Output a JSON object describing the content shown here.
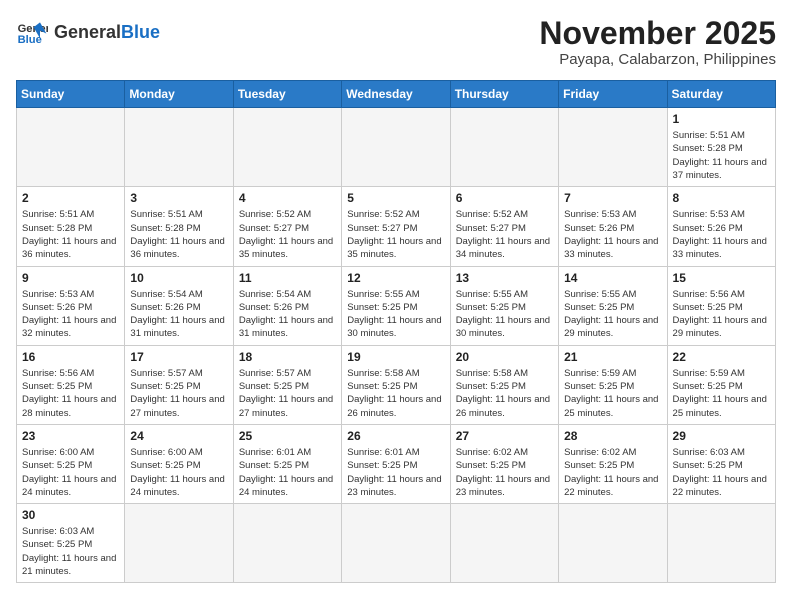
{
  "logo": {
    "general": "General",
    "blue": "Blue"
  },
  "header": {
    "month": "November 2025",
    "location": "Payapa, Calabarzon, Philippines"
  },
  "weekdays": [
    "Sunday",
    "Monday",
    "Tuesday",
    "Wednesday",
    "Thursday",
    "Friday",
    "Saturday"
  ],
  "days": {
    "1": {
      "sunrise": "5:51 AM",
      "sunset": "5:28 PM",
      "daylight": "11 hours and 37 minutes."
    },
    "2": {
      "sunrise": "5:51 AM",
      "sunset": "5:28 PM",
      "daylight": "11 hours and 36 minutes."
    },
    "3": {
      "sunrise": "5:51 AM",
      "sunset": "5:28 PM",
      "daylight": "11 hours and 36 minutes."
    },
    "4": {
      "sunrise": "5:52 AM",
      "sunset": "5:27 PM",
      "daylight": "11 hours and 35 minutes."
    },
    "5": {
      "sunrise": "5:52 AM",
      "sunset": "5:27 PM",
      "daylight": "11 hours and 35 minutes."
    },
    "6": {
      "sunrise": "5:52 AM",
      "sunset": "5:27 PM",
      "daylight": "11 hours and 34 minutes."
    },
    "7": {
      "sunrise": "5:53 AM",
      "sunset": "5:26 PM",
      "daylight": "11 hours and 33 minutes."
    },
    "8": {
      "sunrise": "5:53 AM",
      "sunset": "5:26 PM",
      "daylight": "11 hours and 33 minutes."
    },
    "9": {
      "sunrise": "5:53 AM",
      "sunset": "5:26 PM",
      "daylight": "11 hours and 32 minutes."
    },
    "10": {
      "sunrise": "5:54 AM",
      "sunset": "5:26 PM",
      "daylight": "11 hours and 31 minutes."
    },
    "11": {
      "sunrise": "5:54 AM",
      "sunset": "5:26 PM",
      "daylight": "11 hours and 31 minutes."
    },
    "12": {
      "sunrise": "5:55 AM",
      "sunset": "5:25 PM",
      "daylight": "11 hours and 30 minutes."
    },
    "13": {
      "sunrise": "5:55 AM",
      "sunset": "5:25 PM",
      "daylight": "11 hours and 30 minutes."
    },
    "14": {
      "sunrise": "5:55 AM",
      "sunset": "5:25 PM",
      "daylight": "11 hours and 29 minutes."
    },
    "15": {
      "sunrise": "5:56 AM",
      "sunset": "5:25 PM",
      "daylight": "11 hours and 29 minutes."
    },
    "16": {
      "sunrise": "5:56 AM",
      "sunset": "5:25 PM",
      "daylight": "11 hours and 28 minutes."
    },
    "17": {
      "sunrise": "5:57 AM",
      "sunset": "5:25 PM",
      "daylight": "11 hours and 27 minutes."
    },
    "18": {
      "sunrise": "5:57 AM",
      "sunset": "5:25 PM",
      "daylight": "11 hours and 27 minutes."
    },
    "19": {
      "sunrise": "5:58 AM",
      "sunset": "5:25 PM",
      "daylight": "11 hours and 26 minutes."
    },
    "20": {
      "sunrise": "5:58 AM",
      "sunset": "5:25 PM",
      "daylight": "11 hours and 26 minutes."
    },
    "21": {
      "sunrise": "5:59 AM",
      "sunset": "5:25 PM",
      "daylight": "11 hours and 25 minutes."
    },
    "22": {
      "sunrise": "5:59 AM",
      "sunset": "5:25 PM",
      "daylight": "11 hours and 25 minutes."
    },
    "23": {
      "sunrise": "6:00 AM",
      "sunset": "5:25 PM",
      "daylight": "11 hours and 24 minutes."
    },
    "24": {
      "sunrise": "6:00 AM",
      "sunset": "5:25 PM",
      "daylight": "11 hours and 24 minutes."
    },
    "25": {
      "sunrise": "6:01 AM",
      "sunset": "5:25 PM",
      "daylight": "11 hours and 24 minutes."
    },
    "26": {
      "sunrise": "6:01 AM",
      "sunset": "5:25 PM",
      "daylight": "11 hours and 23 minutes."
    },
    "27": {
      "sunrise": "6:02 AM",
      "sunset": "5:25 PM",
      "daylight": "11 hours and 23 minutes."
    },
    "28": {
      "sunrise": "6:02 AM",
      "sunset": "5:25 PM",
      "daylight": "11 hours and 22 minutes."
    },
    "29": {
      "sunrise": "6:03 AM",
      "sunset": "5:25 PM",
      "daylight": "11 hours and 22 minutes."
    },
    "30": {
      "sunrise": "6:03 AM",
      "sunset": "5:25 PM",
      "daylight": "11 hours and 21 minutes."
    }
  }
}
